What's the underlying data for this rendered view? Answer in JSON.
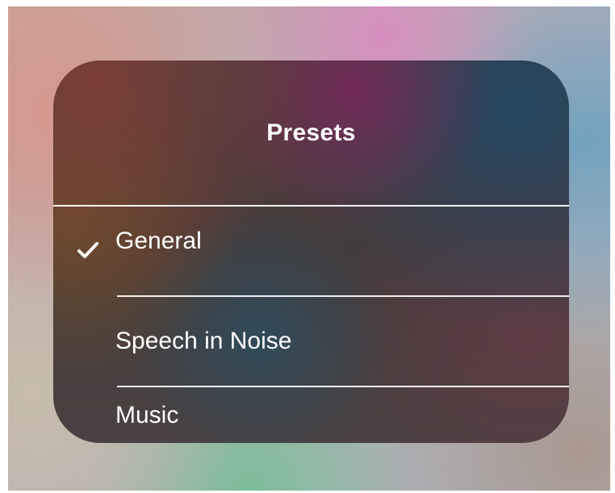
{
  "panel": {
    "title": "Presets"
  },
  "presets": [
    {
      "label": "General",
      "selected": true
    },
    {
      "label": "Speech in Noise",
      "selected": false
    },
    {
      "label": "Music",
      "selected": false
    }
  ],
  "icons": {
    "selected_indicator": "checkmark-icon"
  },
  "colors": {
    "text": "#ffffff",
    "divider": "#ffffff"
  }
}
